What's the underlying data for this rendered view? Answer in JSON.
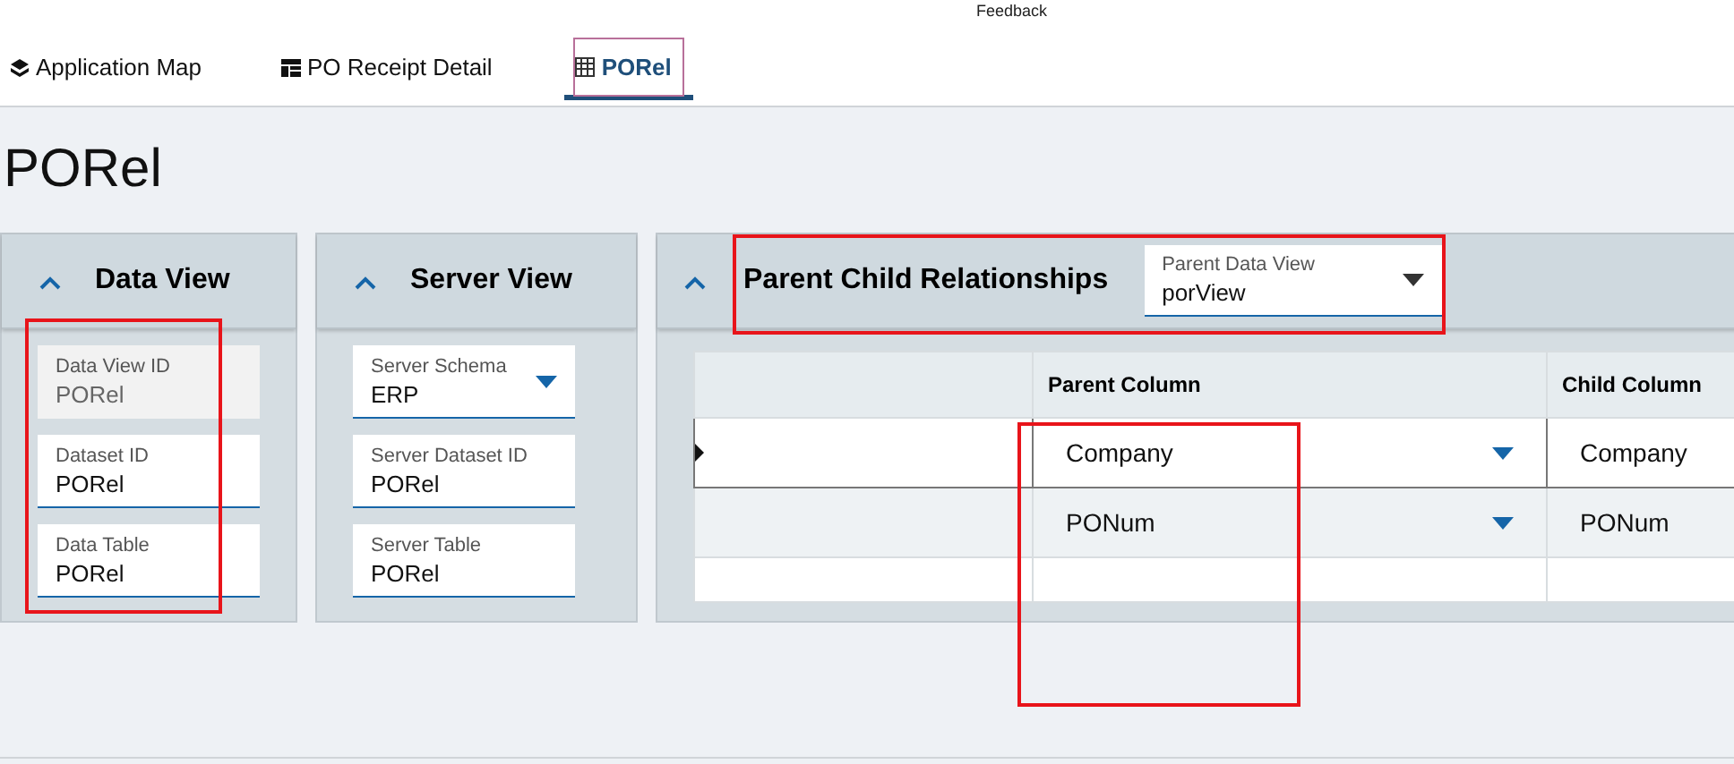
{
  "feedback": "Feedback",
  "tabs": [
    {
      "label": "Application Map",
      "selected": false
    },
    {
      "label": "PO Receipt Detail",
      "selected": false
    },
    {
      "label": "PORel",
      "selected": true
    }
  ],
  "page_title": "PORel",
  "data_view": {
    "title": "Data View",
    "expanded": true,
    "fields": [
      {
        "label": "Data View ID",
        "value": "PORel",
        "disabled": true,
        "dropdown": false
      },
      {
        "label": "Dataset ID",
        "value": "PORel",
        "disabled": false,
        "dropdown": false
      },
      {
        "label": "Data Table",
        "value": "PORel",
        "disabled": false,
        "dropdown": false
      }
    ]
  },
  "server_view": {
    "title": "Server View",
    "expanded": true,
    "fields": [
      {
        "label": "Server Schema",
        "value": "ERP",
        "disabled": false,
        "dropdown": true
      },
      {
        "label": "Server Dataset ID",
        "value": "PORel",
        "disabled": false,
        "dropdown": false
      },
      {
        "label": "Server Table",
        "value": "PORel",
        "disabled": false,
        "dropdown": false
      }
    ]
  },
  "relationships": {
    "title": "Parent Child Relationships",
    "expanded": true,
    "parent_data_view": {
      "label": "Parent Data View",
      "value": "porView"
    },
    "columns": [
      "",
      "Parent Column",
      "Child Column"
    ],
    "rows": [
      {
        "parent": "Company",
        "child": "Company",
        "selected": true
      },
      {
        "parent": "PONum",
        "child": "PONum",
        "selected": false
      },
      {
        "parent": "",
        "child": "",
        "selected": false
      }
    ]
  }
}
